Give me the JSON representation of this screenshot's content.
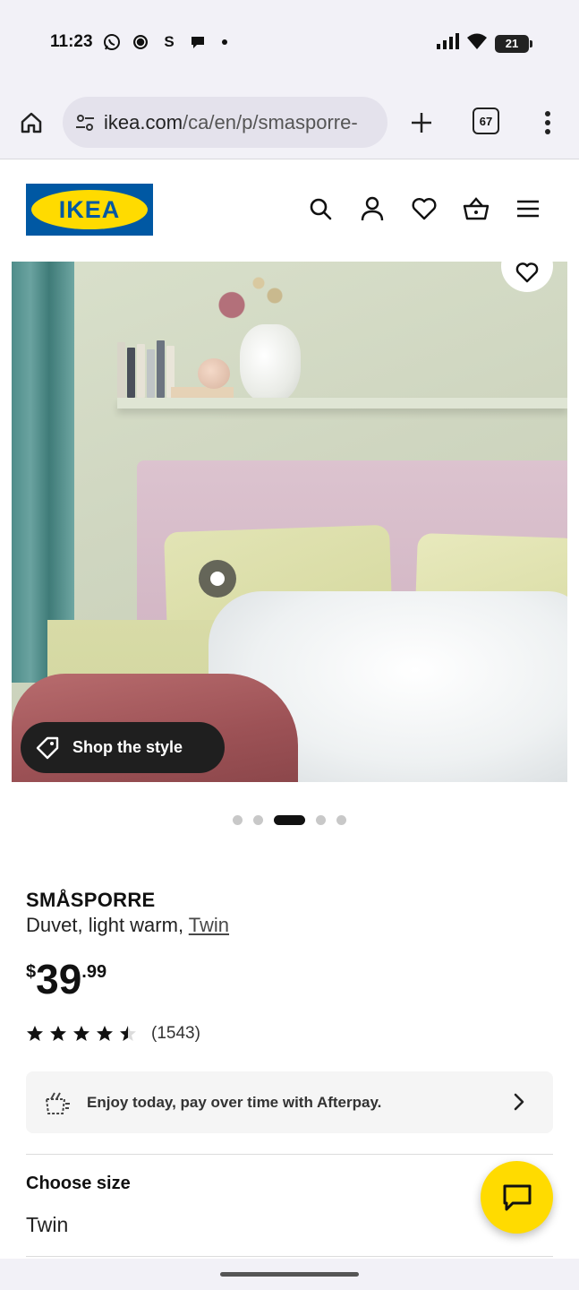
{
  "status_bar": {
    "time": "11:23",
    "app_icons": [
      "whatsapp-icon",
      "signal-icon",
      "s-app-icon",
      "chat-bubble-icon",
      "dot-icon"
    ],
    "s_app_glyph": "S",
    "battery": "21"
  },
  "browser": {
    "url_host": "ikea.com",
    "url_path": "/ca/en/p/smasporre-",
    "tab_count": "67"
  },
  "header": {
    "logo_text": "IKEA",
    "icons": [
      "search-icon",
      "account-icon",
      "favourites-icon",
      "basket-icon",
      "menu-icon"
    ],
    "brand_colors": {
      "blue": "#0058a3",
      "yellow": "#ffdb00"
    }
  },
  "gallery": {
    "shop_the_style": "Shop the style",
    "total_images": 5,
    "active_index": 2
  },
  "product": {
    "name": "SMÅSPORRE",
    "description": "Duvet, light warm,",
    "size_link": "Twin",
    "price_currency": "$",
    "price_integer": "39",
    "price_decimal": ".99",
    "rating": 4.5,
    "rating_max": 5,
    "review_count": "(1543)"
  },
  "afterpay": {
    "text": "Enjoy today, pay over time with Afterpay."
  },
  "size_selector": {
    "label": "Choose size",
    "value": "Twin"
  }
}
